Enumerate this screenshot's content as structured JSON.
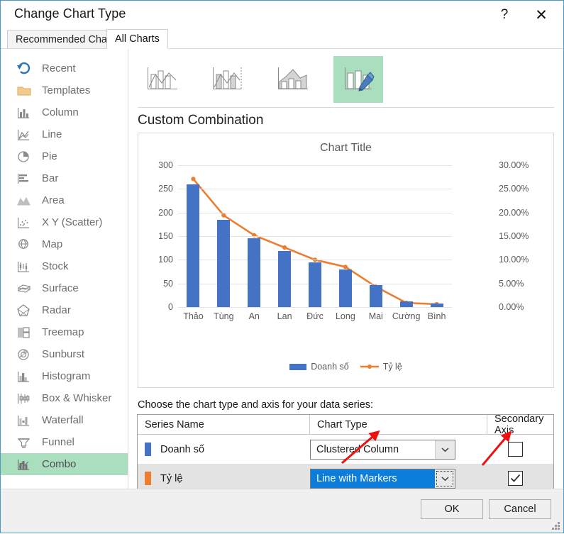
{
  "window": {
    "title": "Change Chart Type",
    "help_icon": "?",
    "close_icon": "✕"
  },
  "tabs": [
    {
      "label": "Recommended Charts",
      "active": false
    },
    {
      "label": "All Charts",
      "active": true
    }
  ],
  "sidebar": {
    "items": [
      {
        "label": "Recent",
        "icon": "recent-icon",
        "selected": false
      },
      {
        "label": "Templates",
        "icon": "templates-icon",
        "selected": false
      },
      {
        "label": "Column",
        "icon": "column-icon",
        "selected": false
      },
      {
        "label": "Line",
        "icon": "line-icon",
        "selected": false
      },
      {
        "label": "Pie",
        "icon": "pie-icon",
        "selected": false
      },
      {
        "label": "Bar",
        "icon": "bar-icon",
        "selected": false
      },
      {
        "label": "Area",
        "icon": "area-icon",
        "selected": false
      },
      {
        "label": "X Y (Scatter)",
        "icon": "scatter-icon",
        "selected": false
      },
      {
        "label": "Map",
        "icon": "map-icon",
        "selected": false
      },
      {
        "label": "Stock",
        "icon": "stock-icon",
        "selected": false
      },
      {
        "label": "Surface",
        "icon": "surface-icon",
        "selected": false
      },
      {
        "label": "Radar",
        "icon": "radar-icon",
        "selected": false
      },
      {
        "label": "Treemap",
        "icon": "treemap-icon",
        "selected": false
      },
      {
        "label": "Sunburst",
        "icon": "sunburst-icon",
        "selected": false
      },
      {
        "label": "Histogram",
        "icon": "histogram-icon",
        "selected": false
      },
      {
        "label": "Box & Whisker",
        "icon": "boxwhisker-icon",
        "selected": false
      },
      {
        "label": "Waterfall",
        "icon": "waterfall-icon",
        "selected": false
      },
      {
        "label": "Funnel",
        "icon": "funnel-icon",
        "selected": false
      },
      {
        "label": "Combo",
        "icon": "combo-icon",
        "selected": true
      }
    ]
  },
  "thumbnails": [
    {
      "name": "clustered-column-line",
      "selected": false
    },
    {
      "name": "clustered-column-line-secondary",
      "selected": false
    },
    {
      "name": "stacked-area-clustered-column",
      "selected": false
    },
    {
      "name": "custom-combination",
      "selected": true
    }
  ],
  "preview": {
    "heading": "Custom Combination"
  },
  "chart_data": {
    "type": "bar",
    "title": "Chart Title",
    "categories": [
      "Thảo",
      "Tùng",
      "An",
      "Lan",
      "Đức",
      "Long",
      "Mai",
      "Cường",
      "Bình"
    ],
    "series": [
      {
        "name": "Doanh số",
        "type": "column",
        "axis": "primary",
        "color": "#4472c4",
        "values": [
          260,
          184,
          145,
          119,
          95,
          80,
          47,
          12,
          8
        ]
      },
      {
        "name": "Tỷ lệ",
        "type": "line-with-markers",
        "axis": "secondary",
        "color": "#ed7d31",
        "values": [
          27.1,
          19.4,
          15.2,
          12.6,
          10.0,
          8.5,
          4.3,
          0.9,
          0.6
        ]
      }
    ],
    "ylabel": "",
    "xlabel": "",
    "ylim": [
      0,
      300
    ],
    "yticks": [
      "0",
      "50",
      "100",
      "150",
      "200",
      "250",
      "300"
    ],
    "y2lim": [
      0,
      30
    ],
    "y2ticks": [
      "0.00%",
      "5.00%",
      "10.00%",
      "15.00%",
      "20.00%",
      "25.00%",
      "30.00%"
    ],
    "grid": true,
    "legend_position": "bottom",
    "legend": [
      "Doanh số",
      "Tỷ lệ"
    ]
  },
  "series_section": {
    "instruction": "Choose the chart type and axis for your data series:",
    "columns": [
      "Series Name",
      "Chart Type",
      "Secondary Axis"
    ],
    "rows": [
      {
        "series_name": "Doanh số",
        "marker_color": "#4472c4",
        "chart_type": "Clustered Column",
        "secondary_axis": false,
        "focused": false
      },
      {
        "series_name": "Tỷ lệ",
        "marker_color": "#ed7d31",
        "chart_type": "Line with Markers",
        "secondary_axis": true,
        "focused": true
      }
    ],
    "checkbox_checked_glyph": "✓"
  },
  "footer": {
    "ok_label": "OK",
    "cancel_label": "Cancel"
  },
  "colors": {
    "accent_blue": "#4472c4",
    "accent_orange": "#ed7d31",
    "selection_green": "#a9dfbf",
    "focus_blue": "#0d7ddb",
    "annotation_red": "#ee1111"
  }
}
